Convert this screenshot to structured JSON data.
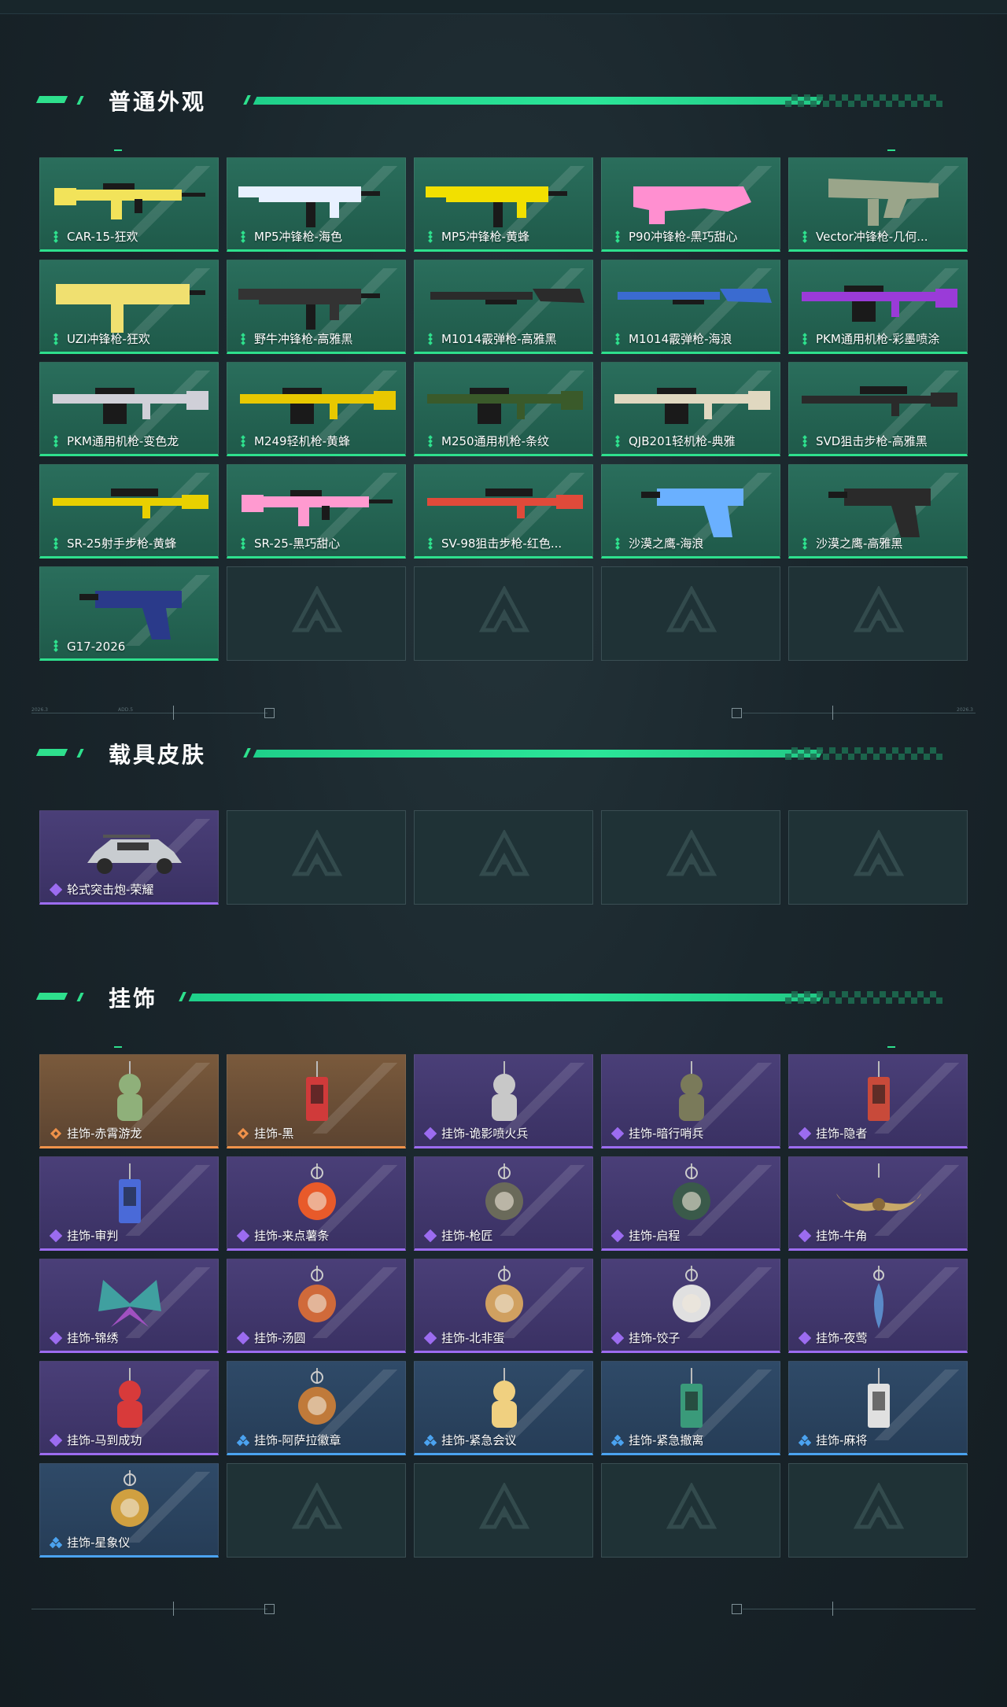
{
  "sections": [
    {
      "title": "普通外观"
    },
    {
      "title": "载具皮肤"
    },
    {
      "title": "挂饰"
    }
  ],
  "deco_labels": [
    "2026.3",
    "ADD.5",
    "2026.3"
  ],
  "rarity_colors": {
    "green": "#2ee08d",
    "purple": "#9c6cf0",
    "orange": "#f0924a",
    "blue": "#4ba3f0"
  },
  "weapons": [
    {
      "name": "CAR-15-狂欢",
      "rarity": "green",
      "icon": "rifle"
    },
    {
      "name": "MP5冲锋枪-海色",
      "rarity": "green",
      "icon": "smg"
    },
    {
      "name": "MP5冲锋枪-黄蜂",
      "rarity": "green",
      "icon": "smg"
    },
    {
      "name": "P90冲锋枪-黑巧甜心",
      "rarity": "green",
      "icon": "p90"
    },
    {
      "name": "Vector冲锋枪-几何...",
      "rarity": "green",
      "icon": "vector"
    },
    {
      "name": "UZI冲锋枪-狂欢",
      "rarity": "green",
      "icon": "uzi"
    },
    {
      "name": "野牛冲锋枪-高雅黑",
      "rarity": "green",
      "icon": "smg"
    },
    {
      "name": "M1014霰弹枪-高雅黑",
      "rarity": "green",
      "icon": "shotgun"
    },
    {
      "name": "M1014霰弹枪-海浪",
      "rarity": "green",
      "icon": "shotgun"
    },
    {
      "name": "PKM通用机枪-彩墨喷涂",
      "rarity": "green",
      "icon": "mg"
    },
    {
      "name": "PKM通用机枪-变色龙",
      "rarity": "green",
      "icon": "mg"
    },
    {
      "name": "M249轻机枪-黄蜂",
      "rarity": "green",
      "icon": "mg"
    },
    {
      "name": "M250通用机枪-条纹",
      "rarity": "green",
      "icon": "mg"
    },
    {
      "name": "QJB201轻机枪-典雅",
      "rarity": "green",
      "icon": "mg"
    },
    {
      "name": "SVD狙击步枪-高雅黑",
      "rarity": "green",
      "icon": "sniper"
    },
    {
      "name": "SR-25射手步枪-黄蜂",
      "rarity": "green",
      "icon": "sniper"
    },
    {
      "name": "SR-25-黑巧甜心",
      "rarity": "green",
      "icon": "rifle"
    },
    {
      "name": "SV-98狙击步枪-红色...",
      "rarity": "green",
      "icon": "sniper"
    },
    {
      "name": "沙漠之鹰-海浪",
      "rarity": "green",
      "icon": "pistol"
    },
    {
      "name": "沙漠之鹰-高雅黑",
      "rarity": "green",
      "icon": "pistol"
    },
    {
      "name": "G17-2026",
      "rarity": "green",
      "icon": "pistol"
    }
  ],
  "weapon_colors": [
    "#f2e35a",
    "#e8f0ff",
    "#f2e000",
    "#ff8fd0",
    "#9aa58a",
    "#f0e070",
    "#333333",
    "#2b2b2b",
    "#3a6bd0",
    "#9a3bd8",
    "#d0d0d8",
    "#e8c800",
    "#3a5a2a",
    "#e0d8c0",
    "#2a2a2a",
    "#e8d000",
    "#ff9ad0",
    "#e04a3a",
    "#6ab0ff",
    "#2a2a2a",
    "#2a3a8a"
  ],
  "vehicles": [
    {
      "name": "轮式突击炮-荣耀",
      "rarity": "purple",
      "icon": "vehicle"
    }
  ],
  "charms": [
    {
      "name": "挂饰-赤霄游龙",
      "rarity": "orange",
      "icon": "charm-figure"
    },
    {
      "name": "挂饰-黑",
      "rarity": "orange",
      "icon": "charm-tag"
    },
    {
      "name": "挂饰-诡影喷火兵",
      "rarity": "purple",
      "icon": "charm-figure"
    },
    {
      "name": "挂饰-暗行哨兵",
      "rarity": "purple",
      "icon": "charm-figure"
    },
    {
      "name": "挂饰-隐者",
      "rarity": "purple",
      "icon": "charm-tag"
    },
    {
      "name": "挂饰-审判",
      "rarity": "purple",
      "icon": "charm-tag"
    },
    {
      "name": "挂饰-来点薯条",
      "rarity": "purple",
      "icon": "charm-ring"
    },
    {
      "name": "挂饰-枪匠",
      "rarity": "purple",
      "icon": "charm-ring"
    },
    {
      "name": "挂饰-启程",
      "rarity": "purple",
      "icon": "charm-ring"
    },
    {
      "name": "挂饰-牛角",
      "rarity": "purple",
      "icon": "charm-horns"
    },
    {
      "name": "挂饰-锦绣",
      "rarity": "purple",
      "icon": "charm-butterfly"
    },
    {
      "name": "挂饰-汤圆",
      "rarity": "purple",
      "icon": "charm-ring"
    },
    {
      "name": "挂饰-北非蛋",
      "rarity": "purple",
      "icon": "charm-ring"
    },
    {
      "name": "挂饰-饺子",
      "rarity": "purple",
      "icon": "charm-ring"
    },
    {
      "name": "挂饰-夜莺",
      "rarity": "purple",
      "icon": "charm-feather"
    },
    {
      "name": "挂饰-马到成功",
      "rarity": "purple",
      "icon": "charm-figure"
    },
    {
      "name": "挂饰-阿萨拉徽章",
      "rarity": "blue",
      "icon": "charm-ring"
    },
    {
      "name": "挂饰-紧急会议",
      "rarity": "blue",
      "icon": "charm-figure"
    },
    {
      "name": "挂饰-紧急撤离",
      "rarity": "blue",
      "icon": "charm-tag"
    },
    {
      "name": "挂饰-麻将",
      "rarity": "blue",
      "icon": "charm-tag"
    },
    {
      "name": "挂饰-星象仪",
      "rarity": "blue",
      "icon": "charm-ring"
    }
  ],
  "charm_colors": [
    "#8fb07a",
    "#d03a3a",
    "#c8c8c8",
    "#7a7a5a",
    "#c84a3a",
    "#4a6ad8",
    "#e85a2a",
    "#6a6a5a",
    "#3a5a4a",
    "#c8a868",
    "#40a0a0",
    "#d06a3a",
    "#d0a060",
    "#e0e0e0",
    "#5a8ac8",
    "#d83a3a",
    "#c07a3a",
    "#f0d080",
    "#3a9a7a",
    "#e0e0e0",
    "#d0a040"
  ]
}
